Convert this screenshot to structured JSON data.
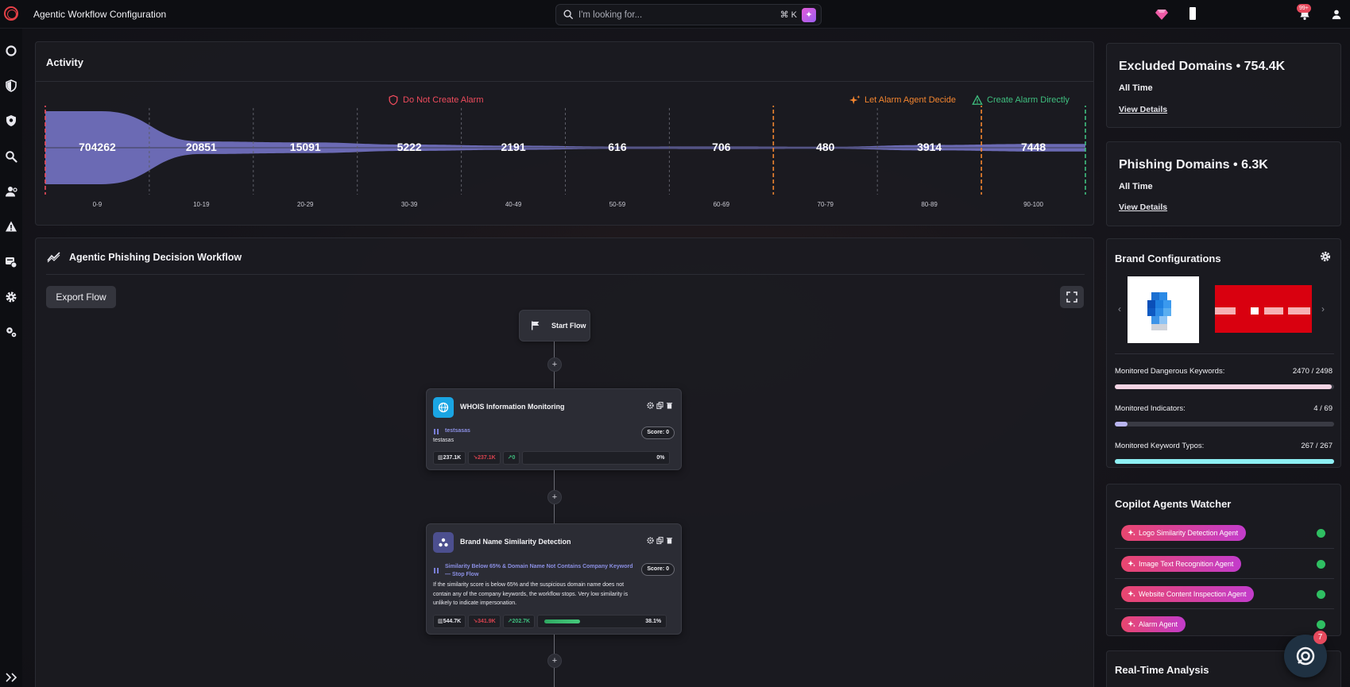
{
  "app": {
    "title": "Agentic Workflow Configuration"
  },
  "search": {
    "placeholder": "I'm looking for...",
    "shortcut": "⌘  K"
  },
  "header": {
    "notifications_badge": "99+"
  },
  "activity": {
    "title": "Activity",
    "legend": {
      "do_not_create": "Do Not Create Alarm",
      "let_agent_decide": "Let Alarm Agent Decide",
      "create_directly": "Create Alarm Directly"
    },
    "colors": {
      "red": "#ee4b5c",
      "orange": "#f3852f",
      "green": "#3fbf7f",
      "funnel": "#7a79cf"
    }
  },
  "chart_data": {
    "type": "area",
    "title": "Activity",
    "categories": [
      "0-9",
      "10-19",
      "20-29",
      "30-39",
      "40-49",
      "50-59",
      "60-69",
      "70-79",
      "80-89",
      "90-100"
    ],
    "values": [
      704262,
      20851,
      15091,
      5222,
      2191,
      616,
      706,
      480,
      3914,
      7448
    ],
    "threshold_markers": [
      {
        "label": "Do Not Create Alarm",
        "at": "0-9",
        "color": "#ee4b5c"
      },
      {
        "label": "Let Alarm Agent Decide",
        "at": "70-79",
        "color": "#f3852f"
      },
      {
        "label": "Create Alarm Directly",
        "at": "90-100",
        "color": "#3fbf7f"
      }
    ]
  },
  "workflow": {
    "title": "Agentic Phishing Decision Workflow",
    "export_label": "Export Flow",
    "start_label": "Start Flow",
    "plus": "+",
    "nodes": [
      {
        "title": "WHOIS Information Monitoring",
        "icon": "globe-icon",
        "icon_color": "#1aa5e3",
        "condition": "testsasas",
        "description": "testasas",
        "score": "Score: 0",
        "total": "237.1K",
        "stopped": "237.1K",
        "passed": "0",
        "percent": "0%",
        "progress": 0
      },
      {
        "title": "Brand Name Similarity Detection",
        "icon": "nodes-icon",
        "icon_color": "#4c4f8f",
        "condition": "Similarity Below 65% & Domain Name Not Contains Company Keyword — Stop Flow",
        "description": "If the similarity score is below 65% and the suspicious domain name does not contain any of the company keywords, the workflow stops. Very low similarity is unlikely to indicate impersonation.",
        "score": "Score: 0",
        "total": "544.7K",
        "stopped": "341.9K",
        "passed": "202.7K",
        "percent": "38.1%",
        "progress": 0.381
      }
    ]
  },
  "excluded": {
    "title": "Excluded Domains • 754.4K",
    "period": "All Time",
    "link": "View Details"
  },
  "phishing": {
    "title": "Phishing Domains • 6.3K",
    "period": "All Time",
    "link": "View Details"
  },
  "brand": {
    "title": "Brand Configurations",
    "meters": [
      {
        "label": "Monitored Dangerous Keywords:",
        "value": "2470 / 2498",
        "ratio": 0.989,
        "color": "#f3d4e4"
      },
      {
        "label": "Monitored Indicators:",
        "value": "4 / 69",
        "ratio": 0.058,
        "color": "#b9b5f0"
      },
      {
        "label": "Monitored Keyword Typos:",
        "value": "267 / 267",
        "ratio": 1.0,
        "color": "#8ef0f4"
      }
    ]
  },
  "copilot": {
    "title": "Copilot Agents Watcher",
    "agents": [
      {
        "name": "Logo Similarity Detection Agent",
        "status_color": "#2fbf62"
      },
      {
        "name": "Image Text Recognition Agent",
        "status_color": "#2fbf62"
      },
      {
        "name": "Website Content Inspection Agent",
        "status_color": "#2fbf62"
      },
      {
        "name": "Alarm Agent",
        "status_color": "#2fbf62"
      }
    ]
  },
  "realtime": {
    "title": "Real-Time Analysis"
  },
  "fab": {
    "badge": "7"
  }
}
